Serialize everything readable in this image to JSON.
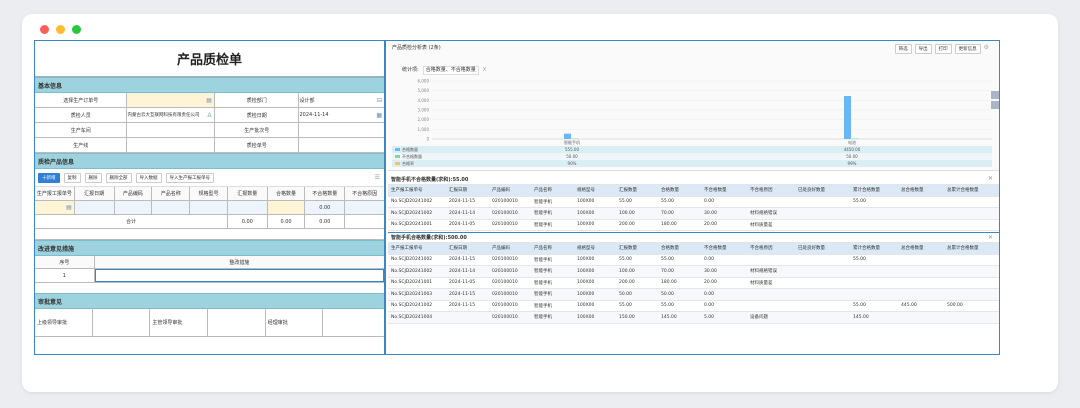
{
  "form": {
    "title": "产品质检单",
    "sections": {
      "basic": "基本信息",
      "products": "质检产品信息",
      "improve": "改进意见措施",
      "approval": "审批意见"
    },
    "basic_rows": [
      {
        "l1": "选择生产订单号",
        "v1": "",
        "l2": "质检部门",
        "v2": "设计部"
      },
      {
        "l1": "质检人员",
        "v1": "内蒙古云大互联网科技有限责任公司",
        "l2": "质检日期",
        "v2": "2024-11-14"
      },
      {
        "l1": "生产车间",
        "v1": "",
        "l2": "生产批次号",
        "v2": ""
      },
      {
        "l1": "生产线",
        "v1": "",
        "l2": "质检单号",
        "v2": ""
      }
    ],
    "toolbar": [
      "十新增",
      "复制",
      "删除",
      "删除全部",
      "导入数据",
      "导入生产报工报单号"
    ],
    "product_headers": [
      "生产报工报单号",
      "汇报日期",
      "产品编码",
      "产品名称",
      "规格型号",
      "汇报数量",
      "合格数量",
      "不合格数量",
      "不合格原因"
    ],
    "product_row": {
      "qty": "0.00"
    },
    "total": {
      "label": "合计",
      "report": "0.00",
      "ok": "0.00",
      "ng": "0.00"
    },
    "improve_headers": [
      "序号",
      "整改措施"
    ],
    "improve_row": "1",
    "approval_labels": [
      "上级领导审批",
      "主管领导审批",
      "经理审批"
    ]
  },
  "chart": {
    "title": "产品质检分析表 (2条)",
    "buttons": [
      "筛选",
      "导出",
      "打印",
      "更新信息"
    ],
    "filters": [
      "统计项:",
      "合格数量、不合格数量",
      "X"
    ],
    "legend": [
      "合格数量",
      "不合格数量",
      "合格率"
    ]
  },
  "chart_data": {
    "type": "bar",
    "categories": [
      "智能手机",
      "电池"
    ],
    "series": [
      {
        "name": "合格数量",
        "values": [
          555,
          4450
        ]
      },
      {
        "name": "不合格数量",
        "values": [
          50,
          50
        ]
      }
    ],
    "ylim": [
      0,
      6000
    ],
    "yticks": [
      "0",
      "1,000",
      "2,000",
      "3,000",
      "4,000",
      "5,000",
      "6,000"
    ],
    "table_rows": [
      {
        "label": "合格数量",
        "values": [
          "555.00",
          "4450.00"
        ]
      },
      {
        "label": "不合格数量",
        "values": [
          "50.00",
          "50.00"
        ]
      },
      {
        "label": "合格率",
        "values": [
          "90%",
          "99%"
        ]
      }
    ]
  },
  "table1": {
    "title": "智能手机不合格数量(求和):55.00",
    "headers": [
      "生产报工报单号",
      "汇报日期",
      "产品编码",
      "产品名称",
      "规格型号",
      "汇报数量",
      "合格数量",
      "不合格数量",
      "不合格原因",
      "已处良好数量",
      "累计合格数量",
      "总合格数量",
      "总累计合格数量"
    ],
    "rows": [
      [
        "No.SCJD20241002",
        "2024-11-15",
        "020100010",
        "智能手机",
        "100X00",
        "55.00",
        "55.00",
        "0.00",
        "",
        "",
        "55.00",
        "",
        ""
      ],
      [
        "No.SCJD20241002",
        "2024-11-14",
        "020100010",
        "智能手机",
        "100X00",
        "100.00",
        "70.00",
        "30.00",
        "材料规格错误",
        "",
        "",
        "",
        ""
      ],
      [
        "No.SCJD20241001",
        "2024-11-05",
        "020100010",
        "智能手机",
        "100X00",
        "200.00",
        "180.00",
        "20.00",
        "材料质量差",
        "",
        "",
        "",
        ""
      ]
    ]
  },
  "table2": {
    "title": "智能手机合格数量(求和):500.00",
    "headers": [
      "生产报工报单号",
      "汇报日期",
      "产品编码",
      "产品名称",
      "规格型号",
      "汇报数量",
      "合格数量",
      "不合格数量",
      "不合格原因",
      "已处良好数量",
      "累计合格数量",
      "总合格数量",
      "总累计合格数量"
    ],
    "rows": [
      [
        "No.SCJD20241002",
        "2024-11-15",
        "020100010",
        "智能手机",
        "100X00",
        "55.00",
        "55.00",
        "0.00",
        "",
        "",
        "55.00",
        "",
        ""
      ],
      [
        "No.SCJD20241002",
        "2024-11-14",
        "020100010",
        "智能手机",
        "100X00",
        "100.00",
        "70.00",
        "30.00",
        "材料规格错误",
        "",
        "",
        "",
        ""
      ],
      [
        "No.SCJD20241001",
        "2024-11-05",
        "020100010",
        "智能手机",
        "100X00",
        "200.00",
        "180.00",
        "20.00",
        "材料质量差",
        "",
        "",
        "",
        ""
      ],
      [
        "No.SCJD20241003",
        "2024-11-15",
        "020100010",
        "智能手机",
        "100X00",
        "50.00",
        "50.00",
        "0.00",
        "",
        "",
        "",
        "",
        ""
      ],
      [
        "No.SCJD20241002",
        "2024-11-15",
        "020100010",
        "智能手机",
        "100X00",
        "55.00",
        "55.00",
        "0.00",
        "",
        "",
        "55.00",
        "445.00",
        "500.00"
      ],
      [
        "No.SCJD20241004",
        "",
        "020100010",
        "智能手机",
        "100X00",
        "150.00",
        "145.00",
        "5.00",
        "设备问题",
        "",
        "145.00",
        "",
        ""
      ]
    ]
  },
  "colors": {
    "frame": "#3a87c8",
    "section": "#9dd3df",
    "bar_ok": "#6ab7f5",
    "bar_ng": "#7fd6a5",
    "primary": "#2f7fd6",
    "highlight": "#fff4d6"
  }
}
